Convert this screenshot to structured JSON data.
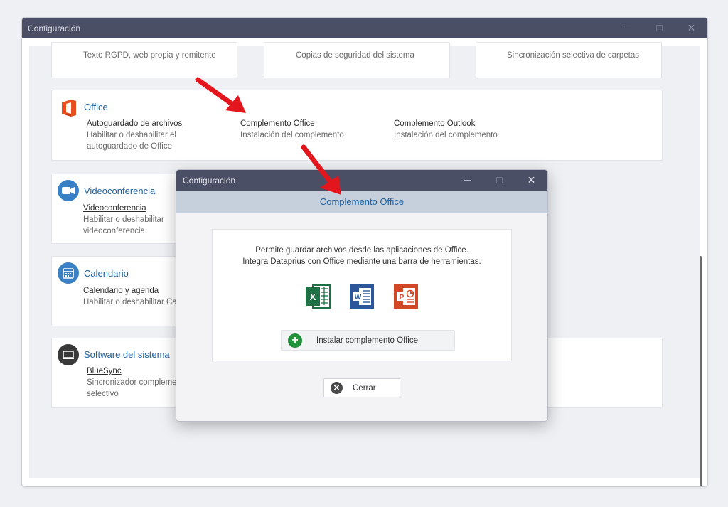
{
  "window": {
    "title": "Configuración"
  },
  "top_cards": [
    {
      "desc": "Texto RGPD, web propia y remitente"
    },
    {
      "desc": "Copias de seguridad del sistema"
    },
    {
      "desc": "Sincronización selectiva de carpetas"
    }
  ],
  "office": {
    "title": "Office",
    "items": [
      {
        "link": "Autoguardado de archivos",
        "desc1": "Habilitar o deshabilitar el",
        "desc2": "autoguardado de Office"
      },
      {
        "link": "Complemento Office",
        "desc1": "Instalación del complemento"
      },
      {
        "link": "Complemento Outlook",
        "desc1": "Instalación del complemento"
      }
    ]
  },
  "video": {
    "title": "Videoconferencia",
    "link": "Videoconferencia",
    "desc1": "Habilitar o deshabilitar",
    "desc2": "videoconferencia"
  },
  "calendar": {
    "title": "Calendario",
    "link": "Calendario y agenda",
    "desc1": "Habilitar o deshabilitar Ca"
  },
  "software": {
    "title": "Software del sistema",
    "link": "BlueSync",
    "desc1": "Sincronizador compleme",
    "desc2": "selectivo"
  },
  "dialog": {
    "title": "Configuración",
    "header": "Complemento Office",
    "desc_line1": "Permite guardar archivos desde las aplicaciones de Office.",
    "desc_line2": "Integra Dataprius con Office mediante una barra de herramientas.",
    "apps": [
      {
        "icon": "excel-icon",
        "letter": "X",
        "color": "#1e7145"
      },
      {
        "icon": "word-icon",
        "letter": "W",
        "color": "#2b579a"
      },
      {
        "icon": "powerpoint-icon",
        "letter": "P",
        "color": "#d24726"
      }
    ],
    "install_label": "Instalar complemento Office",
    "close_label": "Cerrar"
  },
  "colors": {
    "titlebar": "#4b4f66",
    "accent": "#1e5f9c",
    "arrow": "#e3161d",
    "office_orange": "#e8501e"
  }
}
